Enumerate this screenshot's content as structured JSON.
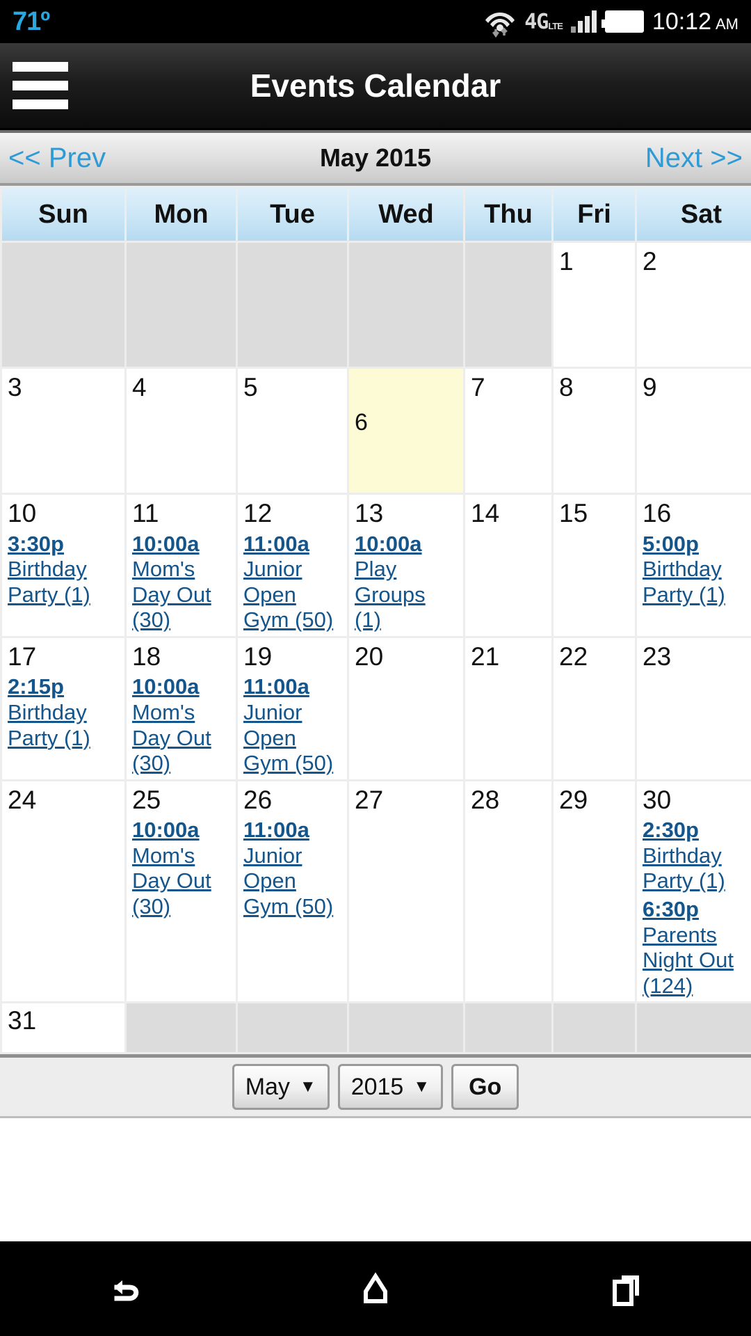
{
  "status_bar": {
    "temperature": "71º",
    "network_type": "4G",
    "network_sub": "LTE",
    "time": "10:12",
    "ampm": "AM",
    "icons": [
      "wifi-icon",
      "data-transfer-icon",
      "signal-bars-icon",
      "battery-icon"
    ],
    "temp_color": "#29a8e0"
  },
  "app_bar": {
    "title": "Events Calendar",
    "menu_icon": "hamburger-menu-icon"
  },
  "month_nav": {
    "prev_label": "<< Prev",
    "title": "May 2015",
    "next_label": "Next >>",
    "link_color": "#2e9bd6"
  },
  "calendar": {
    "weekday_headers": [
      "Sun",
      "Mon",
      "Tue",
      "Wed",
      "Thu",
      "Fri",
      "Sat"
    ],
    "today": 6,
    "event_link_color": "#14558c",
    "today_bg": "#fcfbd6",
    "blank_bg": "#dcdcdc",
    "weeks": [
      [
        {
          "day": "",
          "blank": true,
          "events": []
        },
        {
          "day": "",
          "blank": true,
          "events": []
        },
        {
          "day": "",
          "blank": true,
          "events": []
        },
        {
          "day": "",
          "blank": true,
          "events": []
        },
        {
          "day": "",
          "blank": true,
          "events": []
        },
        {
          "day": "1",
          "events": []
        },
        {
          "day": "2",
          "events": []
        }
      ],
      [
        {
          "day": "3",
          "events": []
        },
        {
          "day": "4",
          "events": []
        },
        {
          "day": "5",
          "events": []
        },
        {
          "day": "6",
          "today": true,
          "events": []
        },
        {
          "day": "7",
          "events": []
        },
        {
          "day": "8",
          "events": []
        },
        {
          "day": "9",
          "events": []
        }
      ],
      [
        {
          "day": "10",
          "events": [
            {
              "time": "3:30p",
              "name": "Birthday Party (1)"
            }
          ]
        },
        {
          "day": "11",
          "events": [
            {
              "time": "10:00a",
              "name": "Mom's Day Out (30)"
            }
          ]
        },
        {
          "day": "12",
          "events": [
            {
              "time": "11:00a",
              "name": "Junior Open Gym (50)"
            }
          ]
        },
        {
          "day": "13",
          "events": [
            {
              "time": "10:00a",
              "name": "Play Groups (1)"
            }
          ]
        },
        {
          "day": "14",
          "events": []
        },
        {
          "day": "15",
          "events": []
        },
        {
          "day": "16",
          "events": [
            {
              "time": "5:00p",
              "name": "Birthday Party (1)"
            }
          ]
        }
      ],
      [
        {
          "day": "17",
          "events": [
            {
              "time": "2:15p",
              "name": "Birthday Party (1)"
            }
          ]
        },
        {
          "day": "18",
          "events": [
            {
              "time": "10:00a",
              "name": "Mom's Day Out (30)"
            }
          ]
        },
        {
          "day": "19",
          "events": [
            {
              "time": "11:00a",
              "name": "Junior Open Gym (50)"
            }
          ]
        },
        {
          "day": "20",
          "events": []
        },
        {
          "day": "21",
          "events": []
        },
        {
          "day": "22",
          "events": []
        },
        {
          "day": "23",
          "events": []
        }
      ],
      [
        {
          "day": "24",
          "events": []
        },
        {
          "day": "25",
          "events": [
            {
              "time": "10:00a",
              "name": "Mom's Day Out (30)"
            }
          ]
        },
        {
          "day": "26",
          "events": [
            {
              "time": "11:00a",
              "name": "Junior Open Gym (50)"
            }
          ]
        },
        {
          "day": "27",
          "events": []
        },
        {
          "day": "28",
          "events": []
        },
        {
          "day": "29",
          "events": []
        },
        {
          "day": "30",
          "events": [
            {
              "time": "2:30p",
              "name": "Birthday Party (1)"
            },
            {
              "time": "6:30p",
              "name": "Parents Night Out (124)"
            }
          ]
        }
      ],
      [
        {
          "day": "31",
          "events": []
        },
        {
          "day": "",
          "blank": true,
          "events": []
        },
        {
          "day": "",
          "blank": true,
          "events": []
        },
        {
          "day": "",
          "blank": true,
          "events": []
        },
        {
          "day": "",
          "blank": true,
          "events": []
        },
        {
          "day": "",
          "blank": true,
          "events": []
        },
        {
          "day": "",
          "blank": true,
          "events": []
        }
      ]
    ]
  },
  "footer_form": {
    "month_value": "May",
    "year_value": "2015",
    "go_label": "Go",
    "caret": "▼"
  },
  "android_nav": {
    "buttons": [
      "back-icon",
      "home-icon",
      "recents-icon"
    ]
  }
}
